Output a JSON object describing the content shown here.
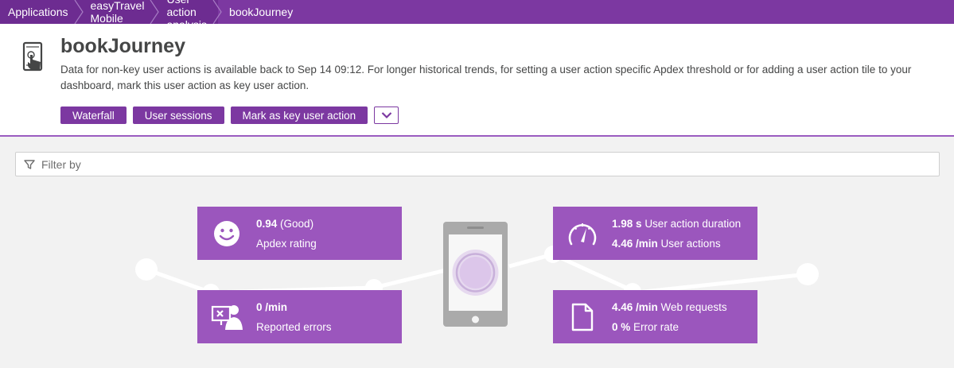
{
  "breadcrumb": {
    "items": [
      "Applications",
      "easyTravel Mobile",
      "User action analysis",
      "bookJourney"
    ]
  },
  "header": {
    "title": "bookJourney",
    "description": "Data for non-key user actions is available back to Sep 14 09:12. For longer historical trends, for setting a user action specific Apdex threshold or for adding a user action tile to your dashboard, mark this user action as key user action.",
    "buttons": {
      "waterfall": "Waterfall",
      "sessions": "User sessions",
      "mark_key": "Mark as key user action"
    }
  },
  "filter": {
    "placeholder": "Filter by"
  },
  "tiles": {
    "apdex": {
      "value": "0.94",
      "qualifier": "(Good)",
      "label": "Apdex rating",
      "icon": "smiley-icon"
    },
    "errors": {
      "value": "0 /min",
      "label": "Reported errors",
      "icon": "error-user-icon"
    },
    "duration": {
      "value": "1.98 s",
      "value_label": "User action duration",
      "actions_value": "4.46 /min",
      "actions_label": "User actions",
      "icon": "speedometer-icon"
    },
    "requests": {
      "value": "4.46 /min",
      "value_label": "Web requests",
      "error_value": "0 %",
      "error_label": "Error rate",
      "icon": "document-icon"
    }
  },
  "colors": {
    "brand": "#6d2c91",
    "accent": "#7c38a1",
    "tile": "#9b56bd"
  }
}
